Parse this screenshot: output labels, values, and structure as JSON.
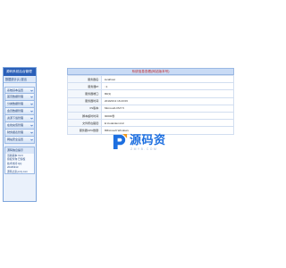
{
  "sidebar": {
    "header": "源码系统后台管理",
    "subheader": "数据统计(1)  退出",
    "items": [
      {
        "label": "系统基本设置"
      },
      {
        "label": "首页数据管理"
      },
      {
        "label": "分类数据管理"
      },
      {
        "label": "会员数据管理"
      },
      {
        "label": "资源下载管理"
      },
      {
        "label": "在线充值管理"
      },
      {
        "label": "财务报表管理"
      },
      {
        "label": "网站安全设置"
      }
    ],
    "info": {
      "title": "源码信息提示",
      "lines": [
        "当前版本:V2.0",
        "授权查询:已授权",
        "技术支持:QQ",
        "20180913",
        "源码之家ymzj.com"
      ]
    }
  },
  "main": {
    "title": "系统信息查看(网站版本号)",
    "rows": [
      {
        "label": "服务器名:",
        "value": "localhost"
      },
      {
        "label": "服务器IP:",
        "value": "::1"
      },
      {
        "label": "服务器端口:",
        "value": "80(3)"
      },
      {
        "label": "服务器时间:",
        "value": "2019/2/13 16:23:06"
      },
      {
        "label": "IIS版本:",
        "value": "Microsoft-IIS/7.5"
      },
      {
        "label": "脚本超时时间:",
        "value": "90000秒"
      },
      {
        "label": "文件所在路径:",
        "value": "E:\\code\\demo\\1\\"
      },
      {
        "label": "服务器CPU数量:",
        "value": "8Microsoft Windows"
      }
    ]
  },
  "watermark": {
    "brand": "源码资",
    "domain": "ZMYB.COM",
    "color": "#1d6fe0"
  }
}
